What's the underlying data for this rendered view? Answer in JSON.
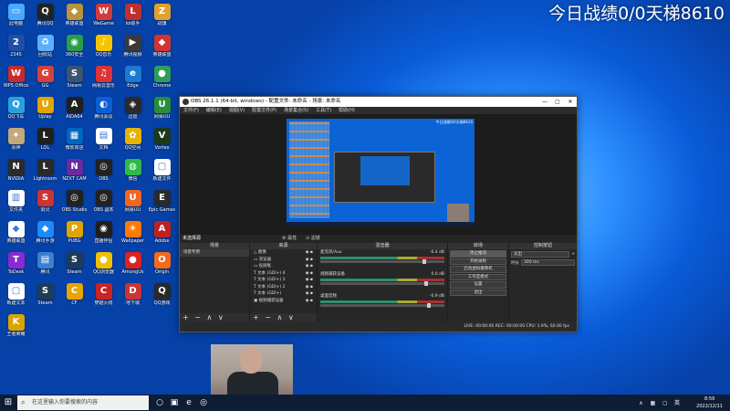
{
  "overlay_text": "今日战绩0/0天梯8610",
  "desktop_icons": [
    {
      "label": "此电脑",
      "glyph": "▭",
      "color": "#4aa8ff"
    },
    {
      "label": "腾讯QQ",
      "glyph": "Q",
      "color": "#222"
    },
    {
      "label": "英雄联盟",
      "glyph": "◆",
      "color": "#b8953a"
    },
    {
      "label": "WeGame",
      "glyph": "W",
      "color": "#d13b3b"
    },
    {
      "label": "lol助手",
      "glyph": "L",
      "color": "#c03030"
    },
    {
      "label": "战旗",
      "glyph": "Z",
      "color": "#e0a030"
    },
    {
      "label": "2345",
      "glyph": "2",
      "color": "#1e4fa8"
    },
    {
      "label": "回收站",
      "glyph": "♻",
      "color": "#5ab0ff"
    },
    {
      "label": "360安全",
      "glyph": "◉",
      "color": "#2a9d4a"
    },
    {
      "label": "QQ音乐",
      "glyph": "♪",
      "color": "#f5c400"
    },
    {
      "label": "腾讯视频",
      "glyph": "▶",
      "color": "#3a3a3a"
    },
    {
      "label": "英雄联盟",
      "glyph": "◆",
      "color": "#d23434"
    },
    {
      "label": "WPS Office",
      "glyph": "W",
      "color": "#c72b2b"
    },
    {
      "label": "GG",
      "glyph": "G",
      "color": "#d84040"
    },
    {
      "label": "Steam",
      "glyph": "S",
      "color": "#3a5570"
    },
    {
      "label": "网易云音乐",
      "glyph": "♫",
      "color": "#d33"
    },
    {
      "label": "Edge",
      "glyph": "e",
      "color": "#1b7ad1"
    },
    {
      "label": "Chrome",
      "glyph": "●",
      "color": "#2d9d5a"
    },
    {
      "label": "QQ飞车",
      "glyph": "Q",
      "color": "#29a0e0"
    },
    {
      "label": "Uplay",
      "glyph": "U",
      "color": "#e2a400"
    },
    {
      "label": "AIDA64",
      "glyph": "A",
      "color": "#202020"
    },
    {
      "label": "腾讯会议",
      "glyph": "◐",
      "color": "#0a5fd8"
    },
    {
      "label": "迅雷",
      "glyph": "◈",
      "color": "#2a2a2a"
    },
    {
      "label": "网易UU",
      "glyph": "U",
      "color": "#2a8d3a"
    },
    {
      "label": "原神",
      "glyph": "✦",
      "color": "#c3a87a"
    },
    {
      "label": "LOL",
      "glyph": "L",
      "color": "#1f1f1f"
    },
    {
      "label": "微软商店",
      "glyph": "▦",
      "color": "#0067c0"
    },
    {
      "label": "文档",
      "glyph": "▤",
      "color": "#ffffff"
    },
    {
      "label": "QQ空间",
      "glyph": "✿",
      "color": "#e5b400"
    },
    {
      "label": "Vortex",
      "glyph": "V",
      "color": "#1a3a1a"
    },
    {
      "label": "NVIDIA",
      "glyph": "N",
      "color": "#2b2b2b"
    },
    {
      "label": "Lightroom",
      "glyph": "L",
      "color": "#2a2a2a"
    },
    {
      "label": "NZXT CAM",
      "glyph": "N",
      "color": "#6a2aa0"
    },
    {
      "label": "OBS",
      "glyph": "◎",
      "color": "#222"
    },
    {
      "label": "微信",
      "glyph": "◍",
      "color": "#2dba4a"
    },
    {
      "label": "新建文件",
      "glyph": "▢",
      "color": "#fff"
    },
    {
      "label": "文件夹",
      "glyph": "▥",
      "color": "#ffffff"
    },
    {
      "label": "剑灵",
      "glyph": "S",
      "color": "#c33"
    },
    {
      "label": "OBS Studio",
      "glyph": "◎",
      "color": "#222"
    },
    {
      "label": "OBS 副本",
      "glyph": "◎",
      "color": "#222"
    },
    {
      "label": "网易UU",
      "glyph": "U",
      "color": "#f26622"
    },
    {
      "label": "Epic Games",
      "glyph": "E",
      "color": "#2a2a2a"
    },
    {
      "label": "英雄联盟",
      "glyph": "◆",
      "color": "#fff"
    },
    {
      "label": "腾讯手游",
      "glyph": "◆",
      "color": "#1a8aff"
    },
    {
      "label": "PUBG",
      "glyph": "P",
      "color": "#e0a400"
    },
    {
      "label": "直播伴侣",
      "glyph": "◉",
      "color": "#1f1f1f"
    },
    {
      "label": "Wallpaper",
      "glyph": "☀",
      "color": "#ff7a00"
    },
    {
      "label": "Adobe",
      "glyph": "A",
      "color": "#c02020"
    },
    {
      "label": "ToDesk",
      "glyph": "T",
      "color": "#8a2ad0"
    },
    {
      "label": "腾讯",
      "glyph": "▤",
      "color": "#3a80d0"
    },
    {
      "label": "Steam",
      "glyph": "S",
      "color": "#1e3b5a"
    },
    {
      "label": "QQ浏览器",
      "glyph": "●",
      "color": "#f0c000"
    },
    {
      "label": "AmongUs",
      "glyph": "●",
      "color": "#d22"
    },
    {
      "label": "Origin",
      "glyph": "O",
      "color": "#f36a1a"
    },
    {
      "label": "新建文本",
      "glyph": "▢",
      "color": "#fff"
    },
    {
      "label": "Steam",
      "glyph": "S",
      "color": "#1e3b5a"
    },
    {
      "label": "CF",
      "glyph": "C",
      "color": "#e8a400"
    },
    {
      "label": "穿越火线",
      "glyph": "C",
      "color": "#c22"
    },
    {
      "label": "地下城",
      "glyph": "D",
      "color": "#cc3333"
    },
    {
      "label": "QQ游戏",
      "glyph": "Q",
      "color": "#2a2a2a"
    },
    {
      "label": "王者荣耀",
      "glyph": "K",
      "color": "#d9a400"
    }
  ],
  "obs": {
    "title": "OBS 26.1.1 (64-bit, windows) - 配置文件: 未命名 - 场景: 未命名",
    "menu": [
      "文件(F)",
      "编辑(E)",
      "视图(V)",
      "配置文件(P)",
      "场景集合(S)",
      "工具(T)",
      "帮助(H)"
    ],
    "status_left": "未选择源",
    "props_btn": "⚙ 属性",
    "filter_btn": "⊙ 滤镜",
    "panel_scenes": "场景",
    "panel_sources": "来源",
    "panel_mixer": "混音器",
    "panel_transitions": "转场",
    "panel_controls": "控制按钮",
    "scene_item": "场景专用",
    "sources": [
      "△ 图像",
      "▭ 浏览器",
      "▭ 投屏框",
      "T 文本 (GDI+) 4",
      "T 文本 (GDI+) 3",
      "T 文本 (GDI+) 2",
      "T 文本 (GDI+)",
      "▣ 视频捕获设备"
    ],
    "mixer": [
      {
        "name": "麦克风/Aux",
        "db": "-6.4 dB"
      },
      {
        "name": "视频捕获设备",
        "db": "0.0 dB"
      },
      {
        "name": "桌面音频",
        "db": "-0.9 dB"
      }
    ],
    "transition_label": "淡出",
    "duration_label": "时长",
    "duration_value": "300 ms",
    "controls": [
      "停止推流",
      "开始录制",
      "启动虚拟摄像机",
      "工作室模式",
      "设置",
      "退出"
    ],
    "status_bar": "LIVE: 00:00:00   REC: 00:00:00   CPU: 1.9%, 60.00 fps",
    "footer_icons": "+ − ∧ ∨"
  },
  "inner_preview_text": "今日战绩0/0天梯8610",
  "taskbar": {
    "start_icon": "⊞",
    "search_placeholder": "在这里输入你要搜索的内容",
    "apps": [
      "○",
      "▣",
      "e",
      "◎"
    ],
    "tray_icons": "∧ ▦ ◻ 英",
    "time": "8:59",
    "date": "2022/12/11"
  }
}
